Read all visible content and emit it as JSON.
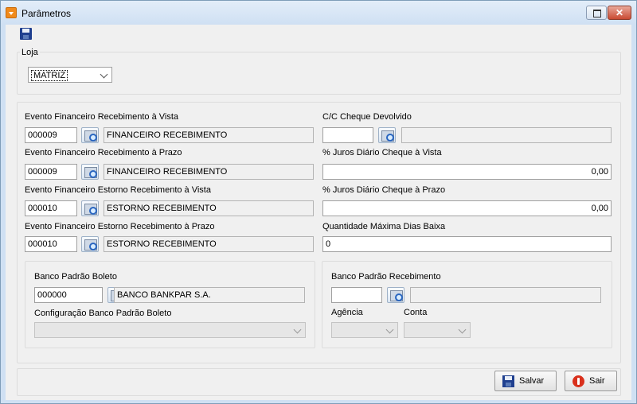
{
  "window": {
    "title": "Parâmetros"
  },
  "loja": {
    "label": "Loja",
    "selected": "MATRIZ"
  },
  "fields": {
    "evento_vista": {
      "label": "Evento Financeiro Recebimento à Vista",
      "code": "000009",
      "description": "FINANCEIRO RECEBIMENTO"
    },
    "evento_prazo": {
      "label": "Evento Financeiro Recebimento à Prazo",
      "code": "000009",
      "description": "FINANCEIRO RECEBIMENTO"
    },
    "estorno_vista": {
      "label": "Evento Financeiro Estorno Recebimento à Vista",
      "code": "000010",
      "description": "ESTORNO RECEBIMENTO"
    },
    "estorno_prazo": {
      "label": "Evento Financeiro Estorno Recebimento à Prazo",
      "code": "000010",
      "description": "ESTORNO RECEBIMENTO"
    },
    "cc_cheque": {
      "label": "C/C Cheque Devolvido",
      "code": "",
      "description": ""
    },
    "juros_vista": {
      "label": "% Juros Diário Cheque à Vista",
      "value": "0,00"
    },
    "juros_prazo": {
      "label": "% Juros Diário Cheque à Prazo",
      "value": "0,00"
    },
    "qtd_dias": {
      "label": "Quantidade Máxima Dias Baixa",
      "value": "0"
    }
  },
  "banco_boleto": {
    "label": "Banco Padrão Boleto",
    "code": "000000",
    "description": "BANCO BANKPAR S.A.",
    "config_label": "Configuração Banco Padrão Boleto",
    "config_value": ""
  },
  "banco_recebimento": {
    "label": "Banco Padrão Recebimento",
    "code": "",
    "description": "",
    "agencia_label": "Agência",
    "conta_label": "Conta"
  },
  "buttons": {
    "save": "Salvar",
    "exit": "Sair"
  }
}
